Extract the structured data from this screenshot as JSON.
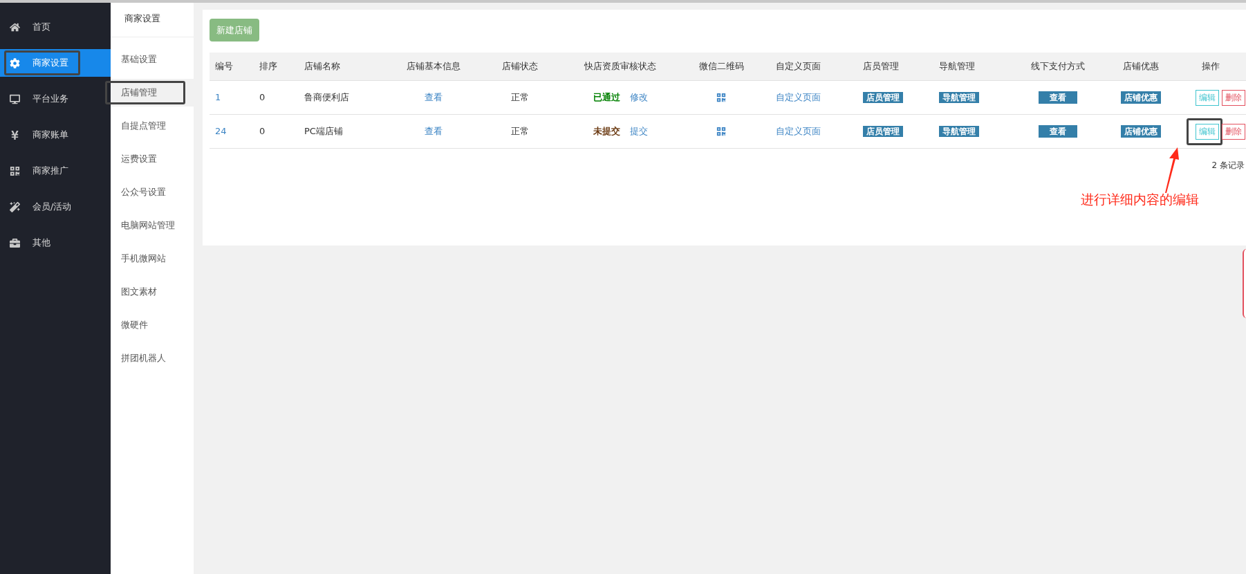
{
  "nav": {
    "items": [
      {
        "label": "首页",
        "selected": false,
        "highlighted": false
      },
      {
        "label": "商家设置",
        "selected": true,
        "highlighted": true
      },
      {
        "label": "平台业务",
        "selected": false,
        "highlighted": false
      },
      {
        "label": "商家账单",
        "selected": false,
        "highlighted": false
      },
      {
        "label": "商家推广",
        "selected": false,
        "highlighted": false
      },
      {
        "label": "会员/活动",
        "selected": false,
        "highlighted": false
      },
      {
        "label": "其他",
        "selected": false,
        "highlighted": false
      }
    ]
  },
  "subnav": {
    "title": "商家设置",
    "items": [
      {
        "label": "基础设置",
        "selected": false,
        "highlighted": false
      },
      {
        "label": "店铺管理",
        "selected": true,
        "highlighted": true
      },
      {
        "label": "自提点管理",
        "selected": false,
        "highlighted": false
      },
      {
        "label": "运费设置",
        "selected": false,
        "highlighted": false
      },
      {
        "label": "公众号设置",
        "selected": false,
        "highlighted": false
      },
      {
        "label": "电脑网站管理",
        "selected": false,
        "highlighted": false
      },
      {
        "label": "手机微网站",
        "selected": false,
        "highlighted": false
      },
      {
        "label": "图文素材",
        "selected": false,
        "highlighted": false
      },
      {
        "label": "微硬件",
        "selected": false,
        "highlighted": false
      },
      {
        "label": "拼团机器人",
        "selected": false,
        "highlighted": false
      }
    ]
  },
  "new_store_button": "新建店铺",
  "table": {
    "columns": [
      "编号",
      "排序",
      "店铺名称",
      "店铺基本信息",
      "店铺状态",
      "快店资质审核状态",
      "微信二维码",
      "自定义页面",
      "店员管理",
      "导航管理",
      "线下支付方式",
      "店铺优惠",
      "操作"
    ],
    "rows": [
      {
        "id": "1",
        "sort": "0",
        "name": "鲁商便利店",
        "info": "查看",
        "status": "正常",
        "review": {
          "label": "已通过",
          "kind": "approved"
        },
        "review_action": "修改",
        "custom_page": "自定义页面",
        "staff": "店员管理",
        "navigation": "导航管理",
        "payment": "查看",
        "promotion": "店铺优惠",
        "actions": [
          {
            "label": "编辑",
            "kind": "edit",
            "highlighted": false
          },
          {
            "label": "删除",
            "kind": "delete",
            "highlighted": false
          }
        ]
      },
      {
        "id": "24",
        "sort": "0",
        "name": "PC端店铺",
        "info": "查看",
        "status": "正常",
        "review": {
          "label": "未提交",
          "kind": "pending"
        },
        "review_action": "提交",
        "custom_page": "自定义页面",
        "staff": "店员管理",
        "navigation": "导航管理",
        "payment": "查看",
        "promotion": "店铺优惠",
        "actions": [
          {
            "label": "编辑",
            "kind": "edit",
            "highlighted": true
          },
          {
            "label": "删除",
            "kind": "delete",
            "highlighted": false
          }
        ]
      }
    ]
  },
  "record_count": "2 条记录",
  "annotation": {
    "text": "进行详细内容的编辑"
  }
}
